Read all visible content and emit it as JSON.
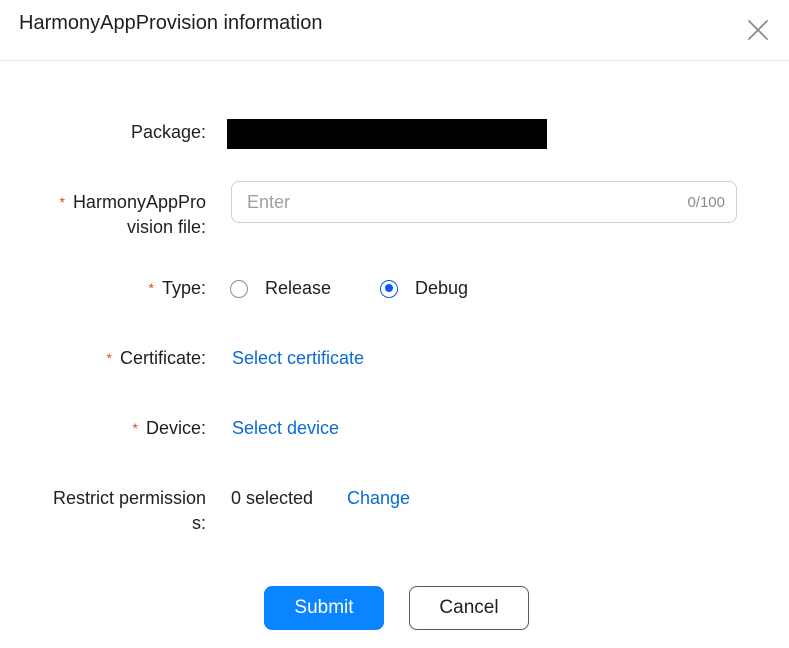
{
  "dialog": {
    "title": "HarmonyAppProvision information"
  },
  "form": {
    "package": {
      "label": "Package:"
    },
    "provision_file": {
      "label_line1": "HarmonyAppPro",
      "label_line2": "vision file:",
      "required_mark": "*",
      "placeholder": "Enter",
      "value": "",
      "counter": "0/100"
    },
    "type": {
      "label": "Type:",
      "required_mark": "*",
      "options": [
        {
          "label": "Release",
          "checked": false
        },
        {
          "label": "Debug",
          "checked": true
        }
      ]
    },
    "certificate": {
      "label": "Certificate:",
      "required_mark": "*",
      "link": "Select certificate"
    },
    "device": {
      "label": "Device:",
      "required_mark": "*",
      "link": "Select device"
    },
    "restrict_permissions": {
      "label_line1": "Restrict permission",
      "label_line2": "s:",
      "selected": "0 selected",
      "change": "Change"
    }
  },
  "buttons": {
    "submit": "Submit",
    "cancel": "Cancel"
  },
  "colors": {
    "primary": "#0a84ff",
    "link": "#0a6bd6",
    "required": "#e84026"
  },
  "icons": {
    "close": "close-icon"
  }
}
